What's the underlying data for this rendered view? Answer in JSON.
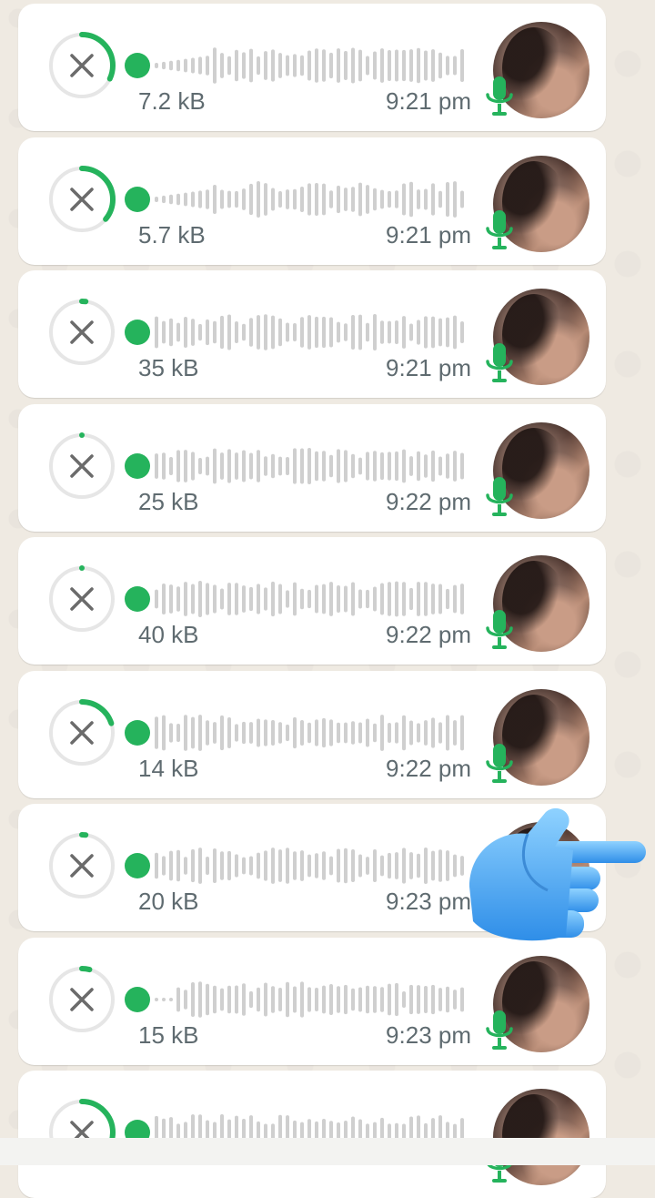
{
  "messages": [
    {
      "size": "7.2 kB",
      "time": "9:21 pm",
      "progress": 0.32
    },
    {
      "size": "5.7 kB",
      "time": "9:21 pm",
      "progress": 0.36
    },
    {
      "size": "35 kB",
      "time": "9:21 pm",
      "progress": 0.02
    },
    {
      "size": "25 kB",
      "time": "9:22 pm",
      "progress": 0.0
    },
    {
      "size": "40 kB",
      "time": "9:22 pm",
      "progress": 0.0
    },
    {
      "size": "14 kB",
      "time": "9:22 pm",
      "progress": 0.2
    },
    {
      "size": "20 kB",
      "time": "9:23 pm",
      "progress": 0.02
    },
    {
      "size": "15 kB",
      "time": "9:23 pm",
      "progress": 0.04
    },
    {
      "size": "",
      "time": "",
      "progress": 0.3
    }
  ],
  "colors": {
    "accent": "#25b35c",
    "ring_track": "#e6e6e6",
    "wave_bar": "#cfcfcf",
    "meta_text": "#5f6b70",
    "bubble": "#ffffff",
    "background": "#efeae2"
  },
  "icons": {
    "cancel": "close-icon",
    "mic": "microphone-icon",
    "overlay": "pointing-hand-icon"
  }
}
